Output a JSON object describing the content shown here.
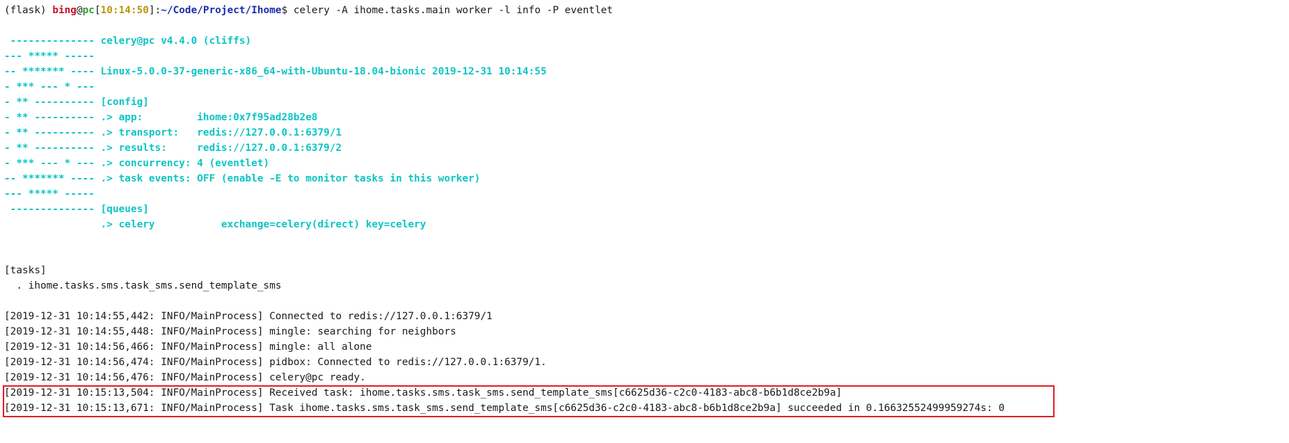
{
  "terminal": {
    "prompt": {
      "env": "(flask) ",
      "user": "bing",
      "at": "@",
      "host": "pc",
      "time_open": "[",
      "time": "10:14:50",
      "time_close": "]:",
      "path": "~/Code/Project/Ihome",
      "symbol": "$ ",
      "command": "celery -A ihome.tasks.main worker -l info -P eventlet"
    },
    "banner": [
      " -------------- celery@pc v4.4.0 (cliffs)",
      "--- ***** -----",
      "-- ******* ---- Linux-5.0.0-37-generic-x86_64-with-Ubuntu-18.04-bionic 2019-12-31 10:14:55",
      "- *** --- * ---",
      "- ** ---------- [config]",
      "- ** ---------- .> app:         ihome:0x7f95ad28b2e8",
      "- ** ---------- .> transport:   redis://127.0.0.1:6379/1",
      "- ** ---------- .> results:     redis://127.0.0.1:6379/2",
      "- *** --- * --- .> concurrency: 4 (eventlet)",
      "-- ******* ---- .> task events: OFF (enable -E to monitor tasks in this worker)",
      "--- ***** -----",
      " -------------- [queues]",
      "                .> celery           exchange=celery(direct) key=celery"
    ],
    "tasks_header": "[tasks]",
    "tasks": [
      "  . ihome.tasks.sms.task_sms.send_template_sms"
    ],
    "log": [
      "[2019-12-31 10:14:55,442: INFO/MainProcess] Connected to redis://127.0.0.1:6379/1",
      "[2019-12-31 10:14:55,448: INFO/MainProcess] mingle: searching for neighbors",
      "[2019-12-31 10:14:56,466: INFO/MainProcess] mingle: all alone",
      "[2019-12-31 10:14:56,474: INFO/MainProcess] pidbox: Connected to redis://127.0.0.1:6379/1.",
      "[2019-12-31 10:14:56,476: INFO/MainProcess] celery@pc ready.",
      "[2019-12-31 10:15:13,504: INFO/MainProcess] Received task: ihome.tasks.sms.task_sms.send_template_sms[c6625d36-c2c0-4183-abc8-b6b1d8ce2b9a]",
      "[2019-12-31 10:15:13,671: INFO/MainProcess] Task ihome.tasks.sms.task_sms.send_template_sms[c6625d36-c2c0-4183-abc8-b6b1d8ce2b9a] succeeded in 0.16632552499959274s: 0"
    ]
  },
  "colors": {
    "background": "#ffffff",
    "text": "#1a1a1a",
    "banner": "#0ec4c4",
    "prompt_user": "#c8102e",
    "prompt_host": "#2e9e2e",
    "prompt_time": "#b8960a",
    "prompt_path": "#1b2fa8",
    "highlight_border": "#e31b23"
  }
}
